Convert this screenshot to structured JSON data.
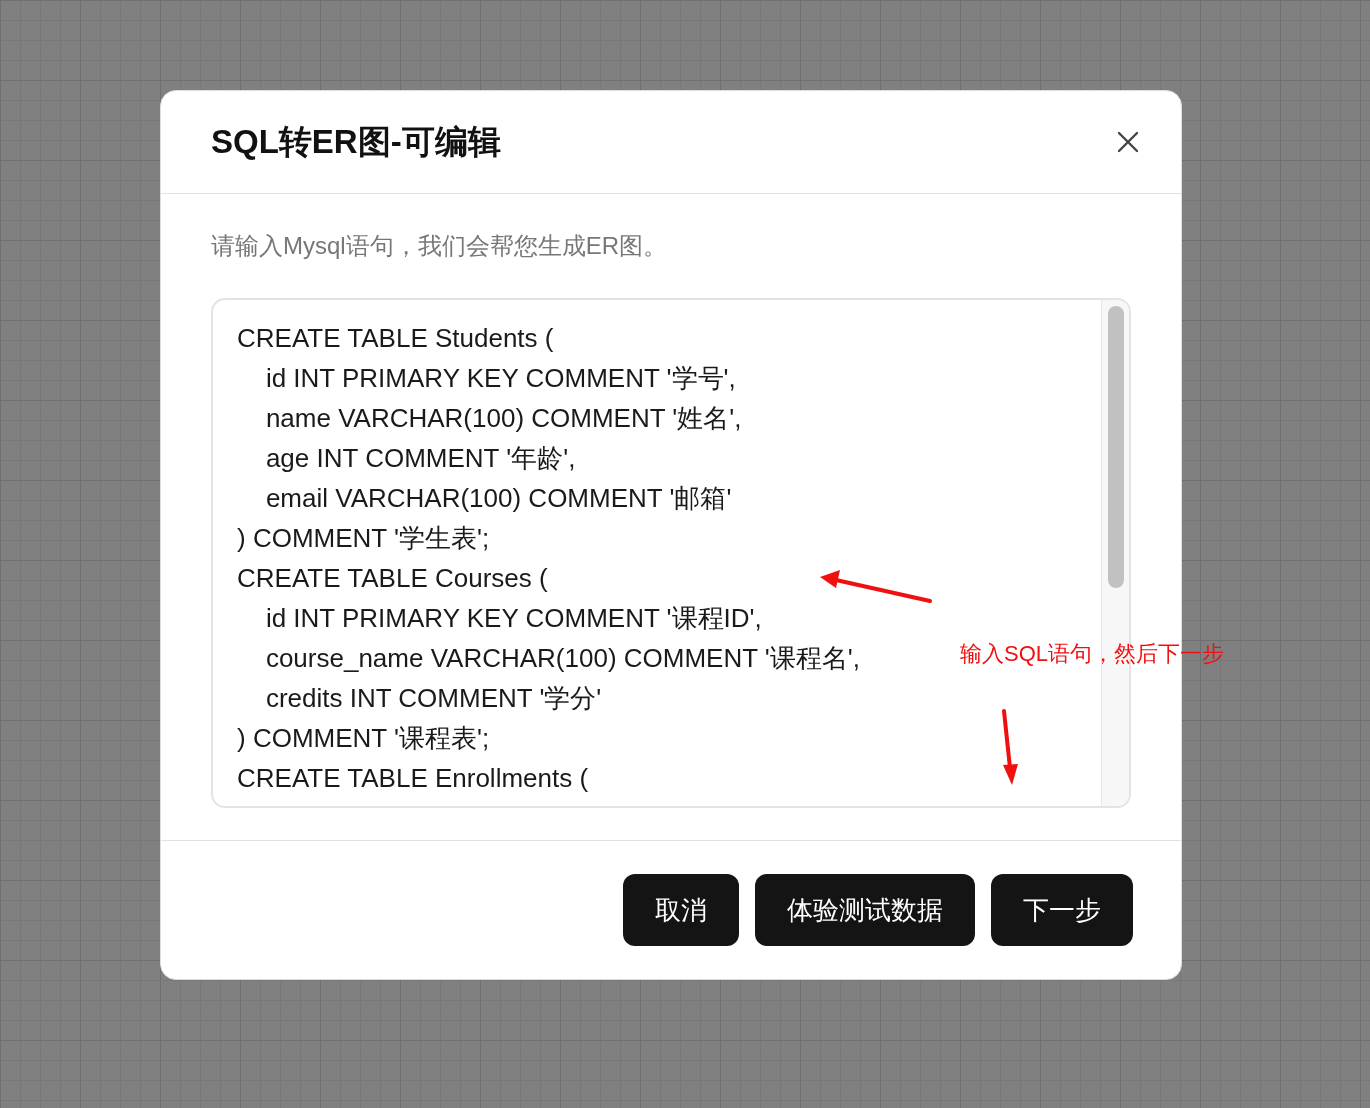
{
  "dialog": {
    "title": "SQL转ER图-可编辑",
    "hint": "请输入Mysql语句，我们会帮您生成ER图。",
    "sql_lines": [
      "CREATE TABLE Students (",
      "    id INT PRIMARY KEY COMMENT '学号',",
      "    name VARCHAR(100) COMMENT '姓名',",
      "    age INT COMMENT '年龄',",
      "    email VARCHAR(100) COMMENT '邮箱'",
      ") COMMENT '学生表';",
      "CREATE TABLE Courses (",
      "    id INT PRIMARY KEY COMMENT '课程ID',",
      "    course_name VARCHAR(100) COMMENT '课程名',",
      "    credits INT COMMENT '学分'",
      ") COMMENT '课程表';",
      "CREATE TABLE Enrollments ("
    ],
    "buttons": [
      "取消",
      "体验测试数据",
      "下一步"
    ]
  },
  "annotation": {
    "text": "输入SQL语句，然后下一步"
  }
}
